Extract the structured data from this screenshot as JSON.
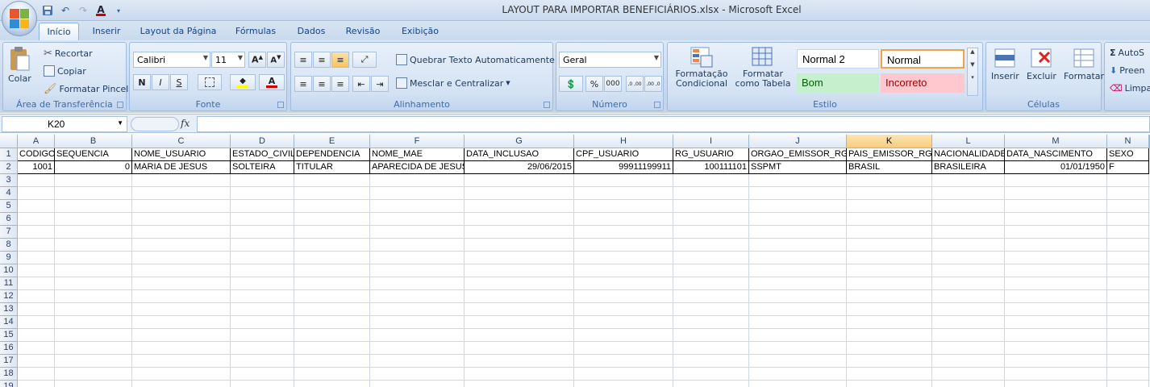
{
  "window": {
    "title": "LAYOUT PARA IMPORTAR BENEFICIÁRIOS.xlsx - Microsoft Excel"
  },
  "quick_access": [
    {
      "icon": "save-icon"
    },
    {
      "icon": "undo-icon"
    },
    {
      "icon": "redo-icon"
    },
    {
      "icon": "font-color-icon"
    },
    {
      "icon": "customize-icon"
    }
  ],
  "tabs": [
    "Início",
    "Inserir",
    "Layout da Página",
    "Fórmulas",
    "Dados",
    "Revisão",
    "Exibição"
  ],
  "ribbon": {
    "clipboard": {
      "label": "Área de Transferência",
      "paste": "Colar",
      "cut": "Recortar",
      "copy": "Copiar",
      "format_painter": "Formatar Pincel"
    },
    "font": {
      "label": "Fonte",
      "family": "Calibri",
      "size": "11",
      "bold": "N",
      "italic": "I",
      "underline": "S"
    },
    "alignment": {
      "label": "Alinhamento",
      "wrap": "Quebrar Texto Automaticamente",
      "merge": "Mesclar e Centralizar"
    },
    "number": {
      "label": "Número",
      "format": "Geral",
      "percent": "%",
      "thousands": "000",
      "inc_decimal": ",0 ,00",
      "dec_decimal": ",00 ,0"
    },
    "styles": {
      "label": "Estilo",
      "conditional": "Formatação Condicional",
      "as_table": "Formatar como Tabela",
      "normal2": "Normal 2",
      "normal": "Normal",
      "good": "Bom",
      "bad": "Incorreto"
    },
    "cells": {
      "label": "Células",
      "insert": "Inserir",
      "delete": "Excluir",
      "format": "Formatar"
    },
    "editing": {
      "autosum": "AutoS",
      "fill": "Preen",
      "clear": "Limpa"
    }
  },
  "formula_bar": {
    "name_box": "K20",
    "fx": "fx",
    "content": ""
  },
  "sheet": {
    "selected_column": "K",
    "columns": [
      "A",
      "B",
      "C",
      "D",
      "E",
      "F",
      "G",
      "H",
      "I",
      "J",
      "K",
      "L",
      "M",
      "N"
    ],
    "rows": [
      "1",
      "2",
      "3",
      "4",
      "5",
      "6",
      "7",
      "8",
      "9",
      "10",
      "11",
      "12",
      "13",
      "14",
      "15",
      "16",
      "17",
      "18",
      "19"
    ],
    "header_row": [
      "CODIGO",
      "SEQUENCIA",
      "NOME_USUARIO",
      "ESTADO_CIVIL",
      "DEPENDENCIA",
      "NOME_MAE",
      "DATA_INCLUSAO",
      "CPF_USUARIO",
      "RG_USUARIO",
      "ORGAO_EMISSOR_RG",
      "PAIS_EMISSOR_RG",
      "NACIONALIDADE",
      "DATA_NASCIMENTO",
      "SEXO"
    ],
    "data_row": [
      "1001",
      "0",
      "MARIA DE JESUS",
      "SOLTEIRA",
      "TITULAR",
      "APARECIDA DE JESUS",
      "29/06/2015",
      "99911199911",
      "100111101",
      "SSPMT",
      "BRASIL",
      "BRASILEIRA",
      "01/01/1950",
      "F"
    ]
  }
}
